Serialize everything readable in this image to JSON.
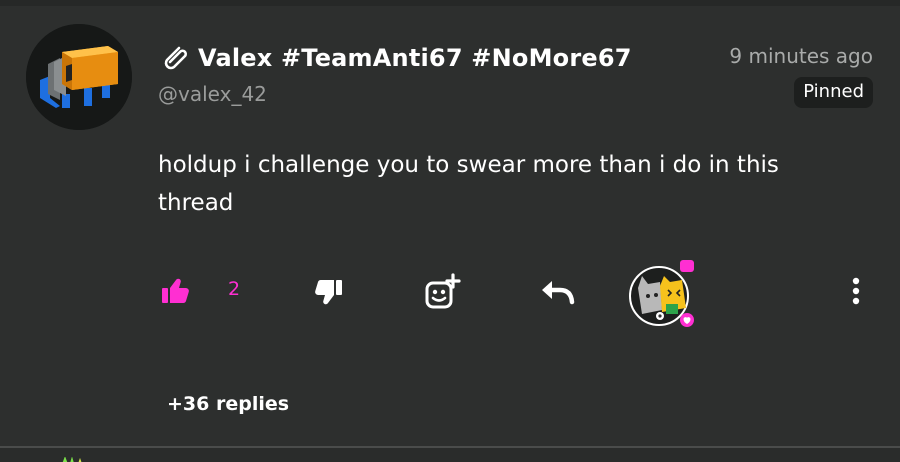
{
  "post": {
    "author": {
      "display_name": "Valex #TeamAnti67 #NoMore67",
      "handle": "@valex_42"
    },
    "timestamp": "9 minutes ago",
    "badge": "Pinned",
    "body": "holdup i challenge you to swear more than i do in this thread",
    "actions": {
      "like_count": "2"
    },
    "replies_label": "+36 replies"
  },
  "colors": {
    "background": "#2d2f2e",
    "accent": "#ff2fd2",
    "muted_text": "#9a9c9b",
    "badge_bg": "#1d1f1e"
  },
  "icons": {
    "author_avatar": "orange-blue-block-avatar",
    "clip": "paperclip-icon",
    "like": "thumbs-up-icon",
    "dislike": "thumbs-down-icon",
    "react": "add-reaction-icon",
    "reply": "reply-arrow-icon",
    "reactor": "reactor-avatar",
    "more": "more-vertical-icon"
  }
}
